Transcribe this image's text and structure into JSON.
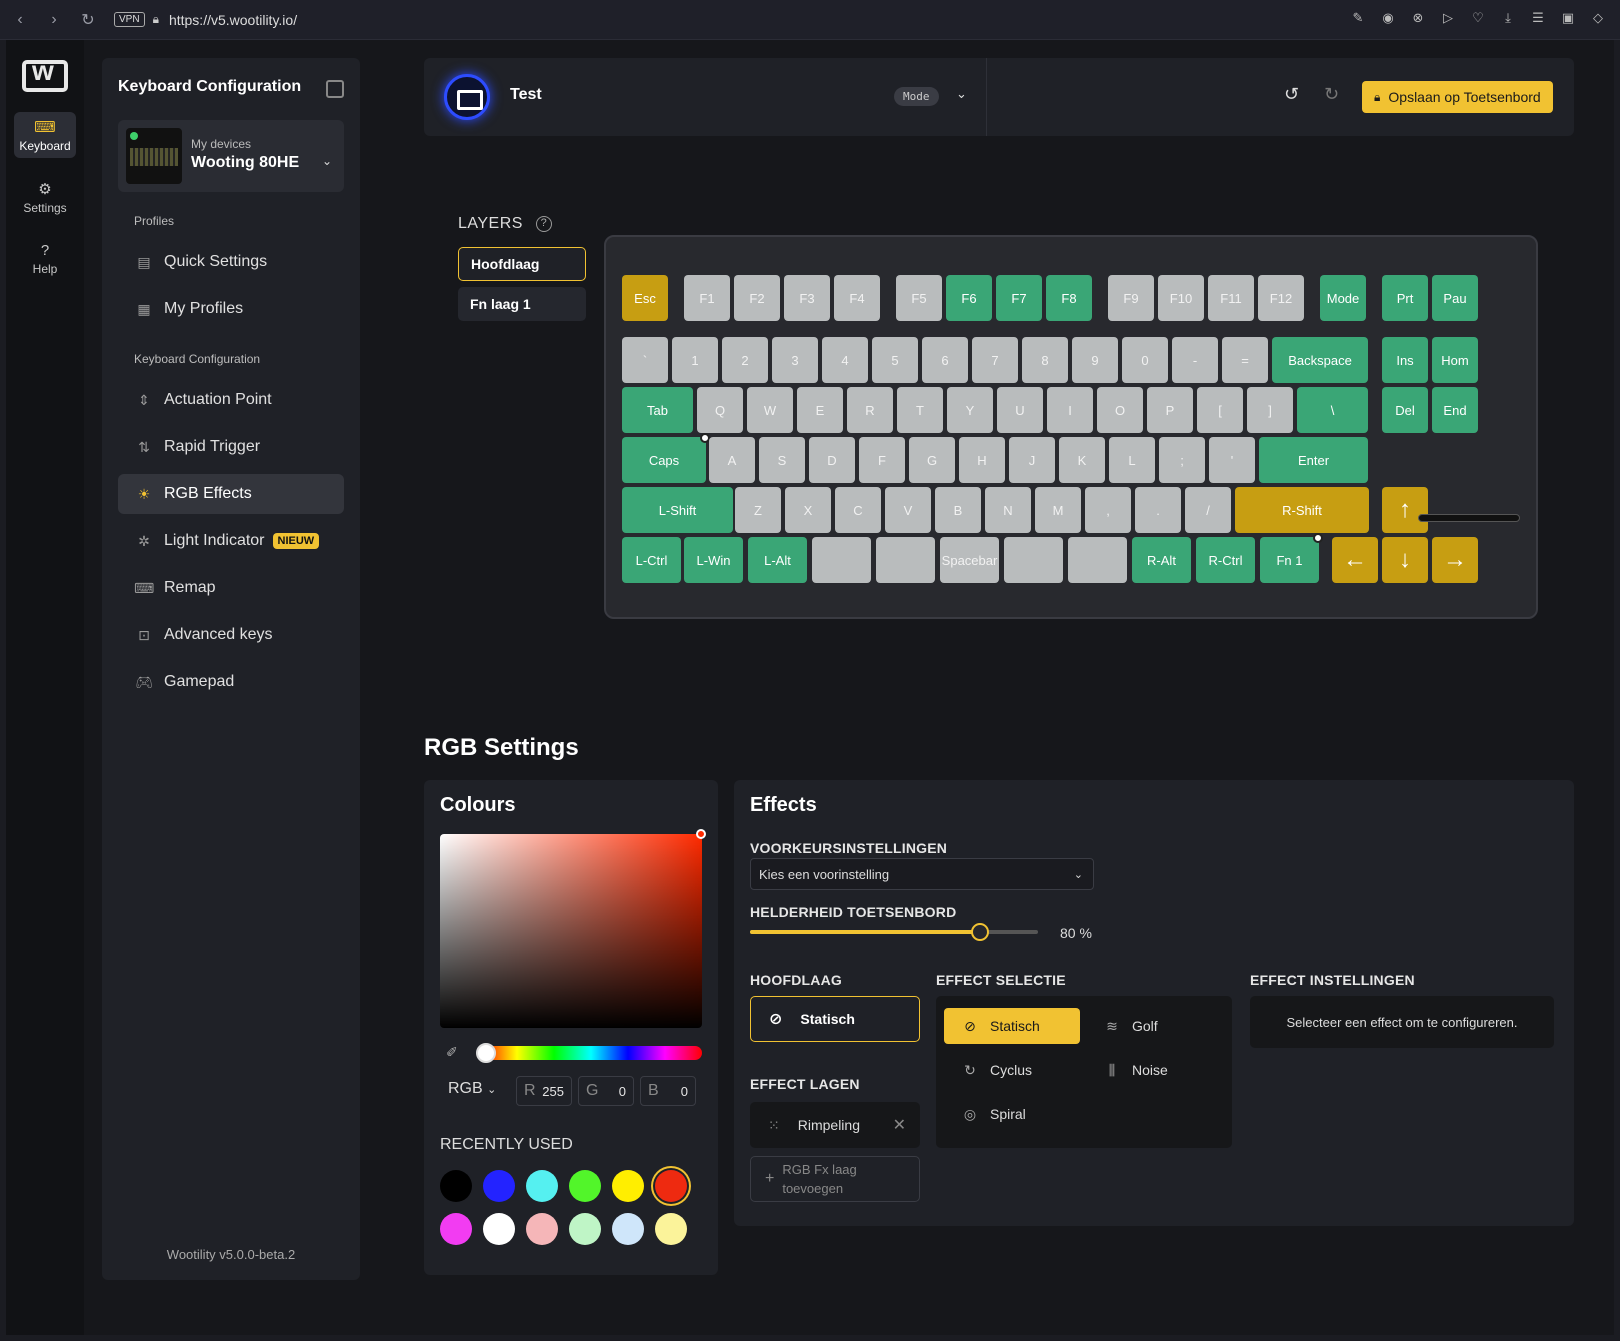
{
  "browser": {
    "url": "https://v5.wootility.io/",
    "vpn": "VPN"
  },
  "rail": {
    "items": [
      {
        "label": "Keyboard",
        "icon": "keyboard-icon"
      },
      {
        "label": "Settings",
        "icon": "gear-icon"
      },
      {
        "label": "Help",
        "icon": "help-icon"
      }
    ]
  },
  "sidebar": {
    "title": "Keyboard Configuration",
    "device": {
      "sub": "My devices",
      "name": "Wooting 80HE"
    },
    "section_profiles": "Profiles",
    "section_config": "Keyboard Configuration",
    "items": [
      {
        "label": "Quick Settings",
        "icon": "quick-settings-icon"
      },
      {
        "label": "My Profiles",
        "icon": "profiles-icon"
      },
      {
        "label": "Actuation Point",
        "icon": "actuation-icon"
      },
      {
        "label": "Rapid Trigger",
        "icon": "rapid-trigger-icon"
      },
      {
        "label": "RGB Effects",
        "icon": "sun-icon"
      },
      {
        "label": "Light Indicator",
        "icon": "light-indicator-icon",
        "badge": "NIEUW"
      },
      {
        "label": "Remap",
        "icon": "remap-icon"
      },
      {
        "label": "Advanced keys",
        "icon": "advanced-keys-icon"
      },
      {
        "label": "Gamepad",
        "icon": "gamepad-icon"
      }
    ],
    "version": "Wootility v5.0.0-beta.2"
  },
  "topbar": {
    "profile_name": "Test",
    "mode": "Mode",
    "save_label": "Opslaan op Toetsenbord"
  },
  "layers": {
    "label": "LAYERS",
    "items": [
      "Hoofdlaag",
      "Fn laag 1"
    ]
  },
  "keyboard": {
    "colors": {
      "grey": "#b9bcbd",
      "teal": "#3aa676",
      "yellow": "#c79e12"
    },
    "row1": [
      "Esc",
      "F1",
      "F2",
      "F3",
      "F4",
      "F5",
      "F6",
      "F7",
      "F8",
      "F9",
      "F10",
      "F11",
      "F12",
      "Mode",
      "Prt",
      "Pau"
    ],
    "row2": [
      "`",
      "1",
      "2",
      "3",
      "4",
      "5",
      "6",
      "7",
      "8",
      "9",
      "0",
      "-",
      "=",
      "Backspace",
      "Ins",
      "Hom"
    ],
    "row3": [
      "Tab",
      "Q",
      "W",
      "E",
      "R",
      "T",
      "Y",
      "U",
      "I",
      "O",
      "P",
      "[",
      "]",
      "\\",
      "Del",
      "End"
    ],
    "row4": [
      "Caps",
      "A",
      "S",
      "D",
      "F",
      "G",
      "H",
      "J",
      "K",
      "L",
      ";",
      "'",
      "Enter"
    ],
    "row5": [
      "L-Shift",
      "Z",
      "X",
      "C",
      "V",
      "B",
      "N",
      "M",
      ",",
      ".",
      "/",
      "R-Shift",
      "↑"
    ],
    "row6": [
      "L-Ctrl",
      "L-Win",
      "L-Alt",
      "",
      "",
      "Spacebar",
      "",
      "",
      "R-Alt",
      "R-Ctrl",
      "Fn 1",
      "←",
      "↓",
      "→"
    ]
  },
  "rgb": {
    "title": "RGB Settings",
    "colours": {
      "title": "Colours",
      "mode": "RGB",
      "r_label": "R",
      "r": "255",
      "g_label": "G",
      "g": "0",
      "b_label": "B",
      "b": "0",
      "recent_title": "RECENTLY USED",
      "recent": [
        "#000000",
        "#2323ff",
        "#55f0f0",
        "#52f52a",
        "#ffee00",
        "#ee2a10",
        "#f23cf2",
        "#ffffff",
        "#f5b6b8",
        "#bff5c6",
        "#cfe6fa",
        "#fbf39a"
      ]
    },
    "effects": {
      "title": "Effects",
      "presets_label": "VOORKEURSINSTELLINGEN",
      "presets_value": "Kies een voorinstelling",
      "brightness_label": "HELDERHEID TOETSENBORD",
      "brightness_value": "80 %",
      "brightness": 0.8,
      "base_label": "HOOFDLAAG",
      "base_effect": "Statisch",
      "layers_label": "EFFECT LAGEN",
      "layer_item": "Rimpeling",
      "add_layer_1": "RGB Fx laag",
      "add_layer_2": "toevoegen",
      "selection_label": "EFFECT SELECTIE",
      "options": [
        "Statisch",
        "Golf",
        "Cyclus",
        "Noise",
        "Spiral"
      ],
      "settings_label": "EFFECT INSTELLINGEN",
      "settings_hint": "Selecteer een effect om te configureren."
    }
  }
}
